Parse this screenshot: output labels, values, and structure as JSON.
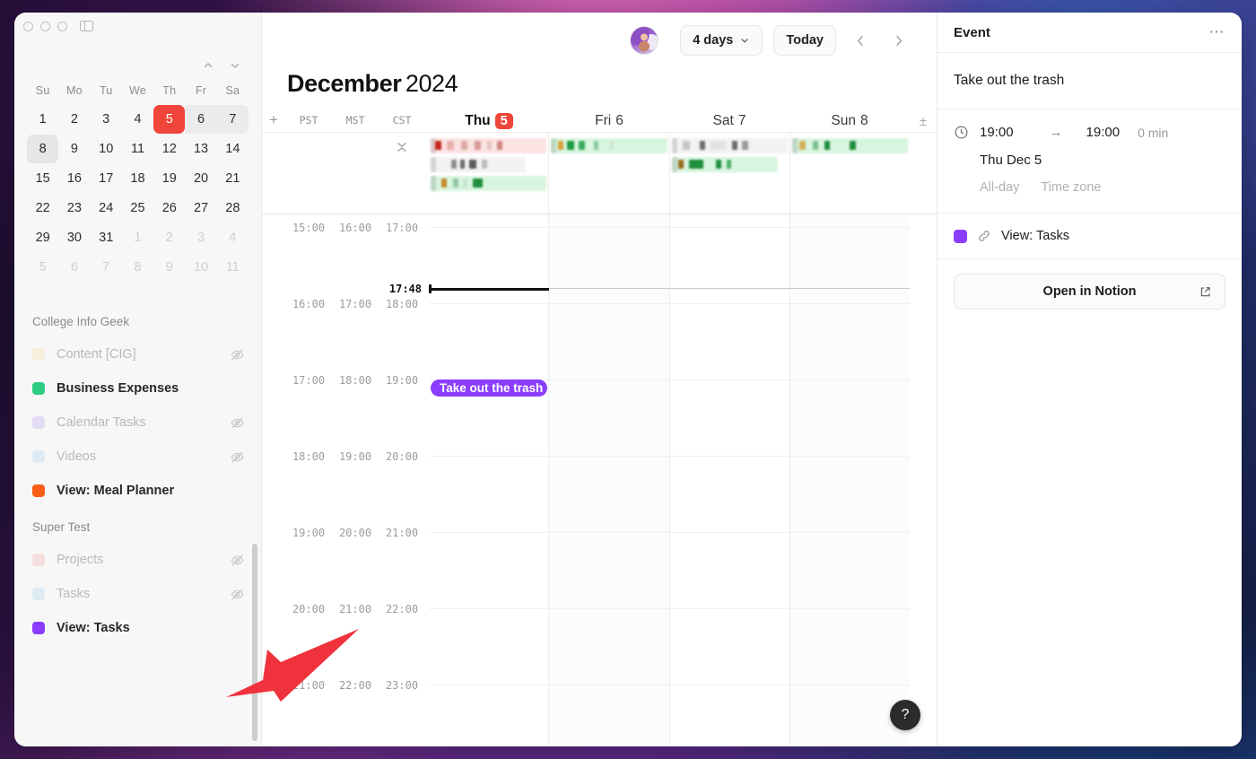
{
  "window": {
    "traffic_lights": [
      "close",
      "minimize",
      "zoom"
    ],
    "panel_toggle_icon": "sidebar-toggle-icon"
  },
  "sidebar": {
    "mini_calendar": {
      "prev_icon": "chevron-up-icon",
      "next_icon": "chevron-down-icon",
      "weekday_headers": [
        "Su",
        "Mo",
        "Tu",
        "We",
        "Th",
        "Fr",
        "Sa"
      ],
      "weeks": [
        [
          {
            "d": "1"
          },
          {
            "d": "2"
          },
          {
            "d": "3"
          },
          {
            "d": "4"
          },
          {
            "d": "5",
            "state": "today"
          },
          {
            "d": "6",
            "state": "inrange"
          },
          {
            "d": "7",
            "state": "inrange-last"
          }
        ],
        [
          {
            "d": "8",
            "state": "selected"
          },
          {
            "d": "9"
          },
          {
            "d": "10"
          },
          {
            "d": "11"
          },
          {
            "d": "12"
          },
          {
            "d": "13"
          },
          {
            "d": "14"
          }
        ],
        [
          {
            "d": "15"
          },
          {
            "d": "16"
          },
          {
            "d": "17"
          },
          {
            "d": "18"
          },
          {
            "d": "19"
          },
          {
            "d": "20"
          },
          {
            "d": "21"
          }
        ],
        [
          {
            "d": "22"
          },
          {
            "d": "23"
          },
          {
            "d": "24"
          },
          {
            "d": "25"
          },
          {
            "d": "26"
          },
          {
            "d": "27"
          },
          {
            "d": "28"
          }
        ],
        [
          {
            "d": "29"
          },
          {
            "d": "30"
          },
          {
            "d": "31"
          },
          {
            "d": "1",
            "state": "muted"
          },
          {
            "d": "2",
            "state": "muted"
          },
          {
            "d": "3",
            "state": "muted"
          },
          {
            "d": "4",
            "state": "muted"
          }
        ],
        [
          {
            "d": "5",
            "state": "muted"
          },
          {
            "d": "6",
            "state": "muted"
          },
          {
            "d": "7",
            "state": "muted"
          },
          {
            "d": "8",
            "state": "muted"
          },
          {
            "d": "9",
            "state": "muted"
          },
          {
            "d": "10",
            "state": "muted"
          },
          {
            "d": "11",
            "state": "muted"
          }
        ]
      ]
    },
    "groups": [
      {
        "title": "College Info Geek",
        "calendars": [
          {
            "label": "Content [CIG]",
            "color": "#f5e0b5",
            "hidden": true
          },
          {
            "label": "Business Expenses",
            "color": "#2ecc82",
            "hidden": false
          },
          {
            "label": "Calendar Tasks",
            "color": "#cdb7f2",
            "hidden": true
          },
          {
            "label": "Videos",
            "color": "#c2dcf0",
            "hidden": true
          },
          {
            "label": "View: Meal Planner",
            "color": "#fb5c16",
            "hidden": false
          }
        ]
      },
      {
        "title": "Super Test",
        "calendars": [
          {
            "label": "Projects",
            "color": "#f6bfbf",
            "hidden": true
          },
          {
            "label": "Tasks",
            "color": "#c2dcf0",
            "hidden": true
          },
          {
            "label": "View: Tasks",
            "color": "#8b3dff",
            "hidden": false
          }
        ]
      }
    ],
    "hidden_icon": "eye-off-icon",
    "scrollbar": "sidebar-scrollbar"
  },
  "toolbar": {
    "avatar": "user-avatar",
    "range_label": "4 days",
    "range_chevron": "chevron-down-icon",
    "today_label": "Today",
    "prev_icon": "chevron-left-icon",
    "next_icon": "chevron-right-icon"
  },
  "header": {
    "month": "December",
    "year": "2024"
  },
  "day_header": {
    "add_icon": "plus-icon",
    "timezones": [
      "PST",
      "MST",
      "CST"
    ],
    "days": [
      {
        "dow": "Thu",
        "num": "5",
        "today": true
      },
      {
        "dow": "Fri",
        "num": "6",
        "today": false
      },
      {
        "dow": "Sat",
        "num": "7",
        "today": false
      },
      {
        "dow": "Sun",
        "num": "8",
        "today": false
      }
    ],
    "right_icon": "plus-minus-icon"
  },
  "all_day": {
    "collapse_icon": "collapse-chevrons-icon",
    "columns": [
      [
        {
          "bg": "#fbe3e1",
          "width": "100%",
          "chips": [
            {
              "l": "4%",
              "w": "5%",
              "c": "#c62a22"
            },
            {
              "l": "14%",
              "w": "6%",
              "c": "#e8b0ab"
            },
            {
              "l": "26%",
              "w": "6%",
              "c": "#ddaaa6"
            },
            {
              "l": "38%",
              "w": "5%",
              "c": "#d89b96"
            },
            {
              "l": "49%",
              "w": "4%",
              "c": "#e6c3bf"
            },
            {
              "l": "57%",
              "w": "5%",
              "c": "#cf8a84"
            }
          ]
        },
        {
          "bg": "#f2f2f2",
          "width": "82%",
          "chips": [
            {
              "l": "22%",
              "w": "5%",
              "c": "#8f8f8f"
            },
            {
              "l": "31%",
              "w": "5%",
              "c": "#6b6b6b"
            },
            {
              "l": "41%",
              "w": "7%",
              "c": "#5c5c5c"
            },
            {
              "l": "54%",
              "w": "5%",
              "c": "#bdbdbd"
            }
          ]
        },
        {
          "bg": "#d8f5df",
          "width": "100%",
          "chips": [
            {
              "l": "9%",
              "w": "5%",
              "c": "#c58a2a"
            },
            {
              "l": "19%",
              "w": "5%",
              "c": "#94c6a2"
            },
            {
              "l": "28%",
              "w": "4%",
              "c": "#c8e6d0"
            },
            {
              "l": "36%",
              "w": "9%",
              "c": "#1f8f3d"
            }
          ]
        }
      ],
      [
        {
          "bg": "#d8f5df",
          "width": "100%",
          "chips": [
            {
              "l": "6%",
              "w": "5%",
              "c": "#d3a33a"
            },
            {
              "l": "14%",
              "w": "6%",
              "c": "#1f9b43"
            },
            {
              "l": "24%",
              "w": "5%",
              "c": "#3aaa5c"
            },
            {
              "l": "37%",
              "w": "4%",
              "c": "#8dcb9c"
            },
            {
              "l": "50%",
              "w": "4%",
              "c": "#cfe9d6"
            }
          ]
        }
      ],
      [
        {
          "bg": "#f2f2f2",
          "width": "100%",
          "chips": [
            {
              "l": "10%",
              "w": "6%",
              "c": "#c6c6c6"
            },
            {
              "l": "24%",
              "w": "5%",
              "c": "#6d6d6d"
            },
            {
              "l": "33%",
              "w": "14%",
              "c": "#e2e2e2"
            },
            {
              "l": "52%",
              "w": "5%",
              "c": "#6d6d6d"
            },
            {
              "l": "61%",
              "w": "5%",
              "c": "#9d9d9d"
            }
          ]
        },
        {
          "bg": "#d8f5df",
          "width": "92%",
          "chips": [
            {
              "l": "6%",
              "w": "5%",
              "c": "#9a6b1e"
            },
            {
              "l": "16%",
              "w": "14%",
              "c": "#1f8f3d"
            },
            {
              "l": "42%",
              "w": "5%",
              "c": "#1f8f3d"
            },
            {
              "l": "52%",
              "w": "4%",
              "c": "#4fae6b"
            }
          ]
        }
      ],
      [
        {
          "bg": "#d8f5df",
          "width": "100%",
          "chips": [
            {
              "l": "6%",
              "w": "6%",
              "c": "#d6b05a"
            },
            {
              "l": "18%",
              "w": "5%",
              "c": "#7ec08e"
            },
            {
              "l": "28%",
              "w": "5%",
              "c": "#1f8f3d"
            },
            {
              "l": "50%",
              "w": "5%",
              "c": "#1f8f3d"
            }
          ]
        }
      ]
    ]
  },
  "grid": {
    "time_rows": [
      {
        "cells": [
          "15:00",
          "16:00",
          "17:00"
        ]
      },
      {
        "cells": [
          "16:00",
          "17:00",
          "18:00"
        ]
      },
      {
        "cells": [
          "17:00",
          "18:00",
          "19:00"
        ]
      },
      {
        "cells": [
          "18:00",
          "19:00",
          "20:00"
        ]
      },
      {
        "cells": [
          "19:00",
          "20:00",
          "21:00"
        ]
      },
      {
        "cells": [
          "20:00",
          "21:00",
          "22:00"
        ]
      },
      {
        "cells": [
          "21:00",
          "22:00",
          "23:00"
        ]
      }
    ],
    "now_label": "17:48",
    "event": {
      "title": "Take out the trash",
      "color": "#8b3dff",
      "column": 0
    }
  },
  "event_panel": {
    "header_title": "Event",
    "more_icon": "ellipsis-icon",
    "title": "Take out the trash",
    "clock_icon": "clock-icon",
    "start_time": "19:00",
    "arrow_icon": "arrow-right-icon",
    "end_time": "19:00",
    "duration": "0 min",
    "date": "Thu Dec 5",
    "all_day_label": "All-day",
    "timezone_label": "Time zone",
    "calendar_color": "#8b3dff",
    "link_icon": "link-icon",
    "calendar_name": "View: Tasks",
    "open_label": "Open in Notion",
    "open_icon": "external-link-icon"
  },
  "help": {
    "icon": "question-mark-icon",
    "label": "?"
  },
  "annotation": {
    "arrow": "red-pointer-arrow",
    "color": "#f0323c"
  }
}
